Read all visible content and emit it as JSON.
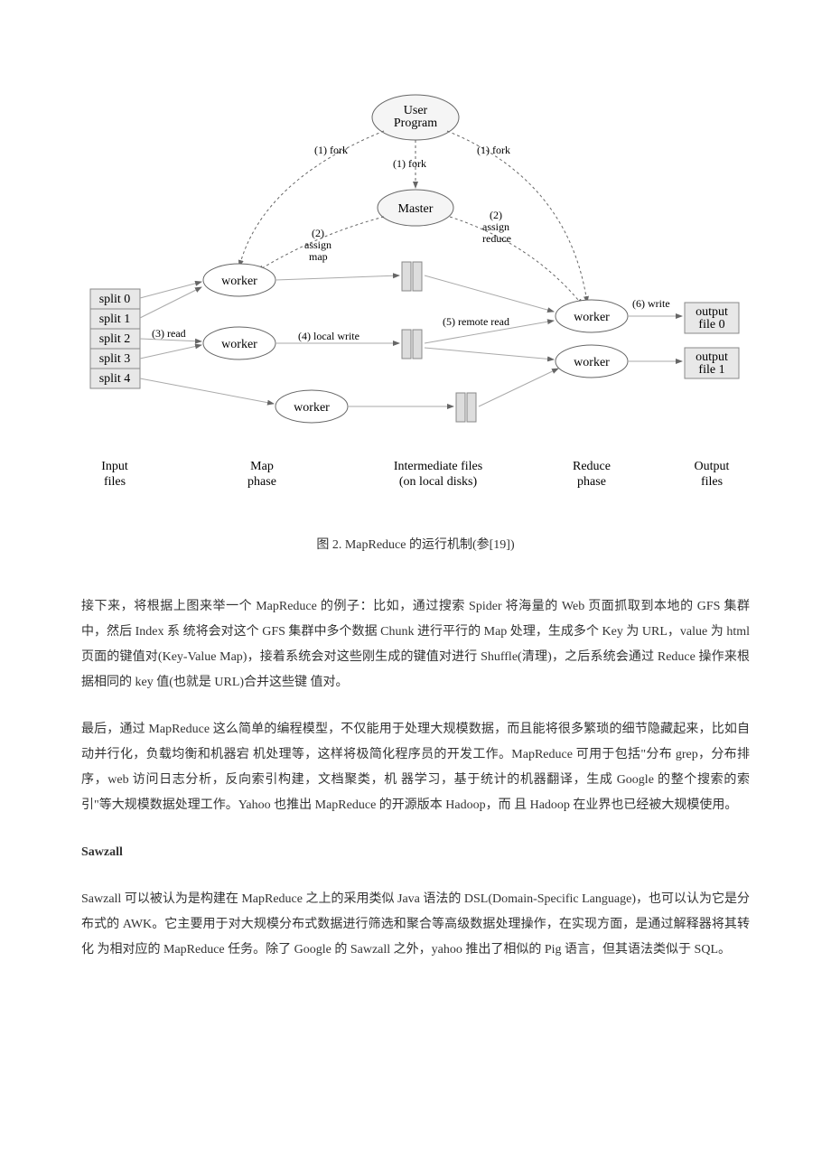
{
  "diagram": {
    "nodes": {
      "user_program": "User\nProgram",
      "master": "Master",
      "worker": "worker",
      "splits": [
        "split 0",
        "split 1",
        "split 2",
        "split 3",
        "split 4"
      ],
      "outputs": [
        "output\nfile 0",
        "output\nfile 1"
      ]
    },
    "edges": {
      "fork1": "(1) fork",
      "fork2": "(1) fork",
      "fork3": "(1) fork",
      "assign_map": "(2)\nassign\nmap",
      "assign_reduce": "(2)\nassign\nreduce",
      "read": "(3) read",
      "local_write": "(4) local write",
      "remote_read": "(5) remote read",
      "write": "(6) write"
    },
    "phases": {
      "input": "Input\nfiles",
      "map": "Map\nphase",
      "intermediate": "Intermediate files\n(on local disks)",
      "reduce": "Reduce\nphase",
      "output": "Output\nfiles"
    }
  },
  "caption": "图 2. MapReduce 的运行机制(参[19])",
  "paragraphs": {
    "p1": "接下来，将根据上图来举一个 MapReduce 的例子：比如，通过搜索 Spider 将海量的 Web 页面抓取到本地的 GFS 集群中，然后 Index 系 统将会对这个 GFS 集群中多个数据 Chunk 进行平行的 Map 处理，生成多个 Key 为 URL，value 为 html 页面的键值对(Key-Value Map)，接着系统会对这些刚生成的键值对进行 Shuffle(清理)，之后系统会通过 Reduce 操作来根据相同的 key 值(也就是 URL)合并这些键 值对。",
    "p2": "最后，通过 MapReduce 这么简单的编程模型，不仅能用于处理大规模数据，而且能将很多繁琐的细节隐藏起来，比如自动并行化，负载均衡和机器宕 机处理等，这样将极简化程序员的开发工作。MapReduce 可用于包括\"分布 grep，分布排序，web 访问日志分析，反向索引构建，文档聚类，机 器学习，基于统计的机器翻译，生成 Google 的整个搜索的索引\"等大规模数据处理工作。Yahoo 也推出 MapReduce 的开源版本 Hadoop，而 且 Hadoop 在业界也已经被大规模使用。",
    "sawzall_head": "Sawzall",
    "p3": "Sawzall 可以被认为是构建在 MapReduce 之上的采用类似 Java 语法的 DSL(Domain-Specific Language)，也可以认为它是分布式的 AWK。它主要用于对大规模分布式数据进行筛选和聚合等高级数据处理操作，在实现方面，是通过解释器将其转化 为相对应的 MapReduce 任务。除了 Google 的 Sawzall 之外，yahoo 推出了相似的 Pig 语言，但其语法类似于 SQL。"
  }
}
